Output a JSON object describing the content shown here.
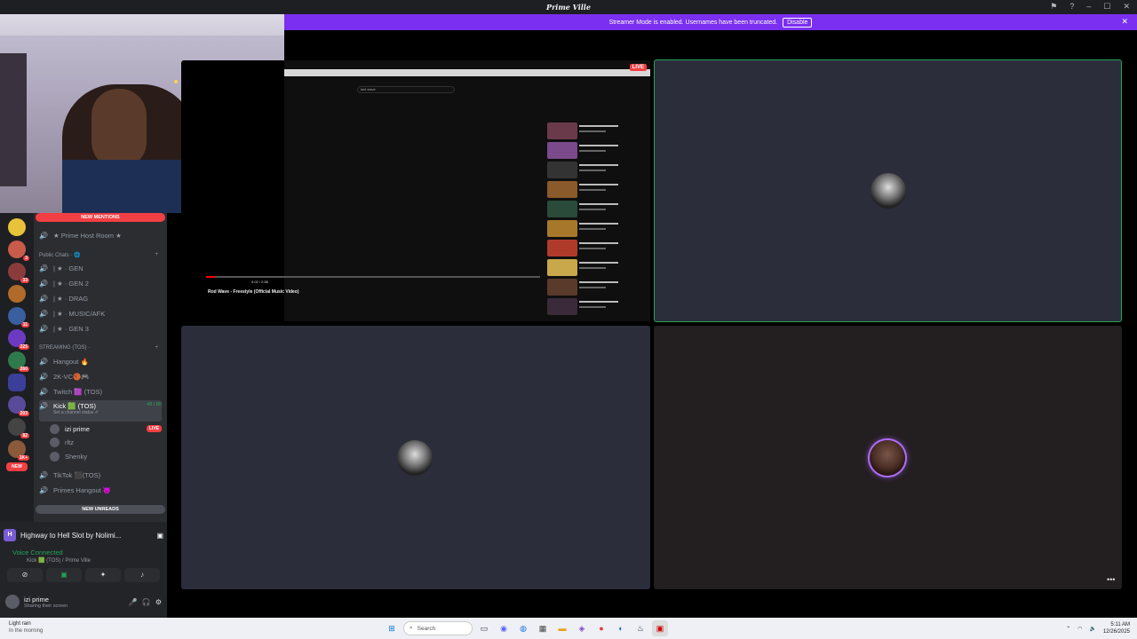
{
  "titlebar": {
    "app_title": "Prime Ville"
  },
  "banner": {
    "text": "Streamer Mode is enabled. Usernames have been truncated.",
    "disable_label": "Disable",
    "close_label": "✕"
  },
  "sidebar": {
    "new_mentions": "NEW MENTIONS",
    "new_unreads": "NEW UNREADS",
    "channels": [
      {
        "label": "★ Prime Host Room ★"
      },
      {
        "label": "| ★ · GEN"
      },
      {
        "label": "| ★ · GEN 2"
      },
      {
        "label": "| ★ · DRAG"
      },
      {
        "label": "| ★ · MUSIC/AFK"
      },
      {
        "label": "| ★ · GEN 3"
      },
      {
        "label": "Hangout 🔥"
      },
      {
        "label": "2K-VC🏀🎮"
      },
      {
        "label": "Twitch 🟪 (TOS)"
      },
      {
        "label": "Kick 🟩 (TOS)"
      },
      {
        "label": "TikTok ⬛(TOS)"
      },
      {
        "label": "Primes Hangout 😈"
      }
    ],
    "categories": [
      {
        "label": "Public Chats · 🌐"
      },
      {
        "label": "STREAMING (TOS) ·"
      }
    ],
    "kick_count": "48 / 80",
    "kick_status": "Set a channel status ✐",
    "voice_users": [
      {
        "name": "izi prime",
        "live": "LIVE"
      },
      {
        "name": "rltz"
      },
      {
        "name": "Shenky"
      }
    ],
    "server_badges": [
      "3",
      "33",
      "11",
      "225",
      "260",
      "203",
      "82",
      "1K+"
    ],
    "new_badge": "NEW"
  },
  "bottom": {
    "activity_title": "Highway to Hell Slot by Nolimi...",
    "voice_connected": "Voice Connected",
    "voice_channel": "Kick 🟩 (TOS) / Prime Ville",
    "username": "izi prime",
    "user_status": "Sharing their screen"
  },
  "stream": {
    "live": "LIVE",
    "search_text": "lost wave",
    "video_time": "0:02 / 2:56",
    "video_title": "Rod Wave - Freestyle (Official Music Video)"
  },
  "taskbar": {
    "weather_title": "Light rain",
    "weather_sub": "In the morning",
    "search_label": "Search",
    "time": "5:11 AM",
    "date": "12/26/2025"
  }
}
